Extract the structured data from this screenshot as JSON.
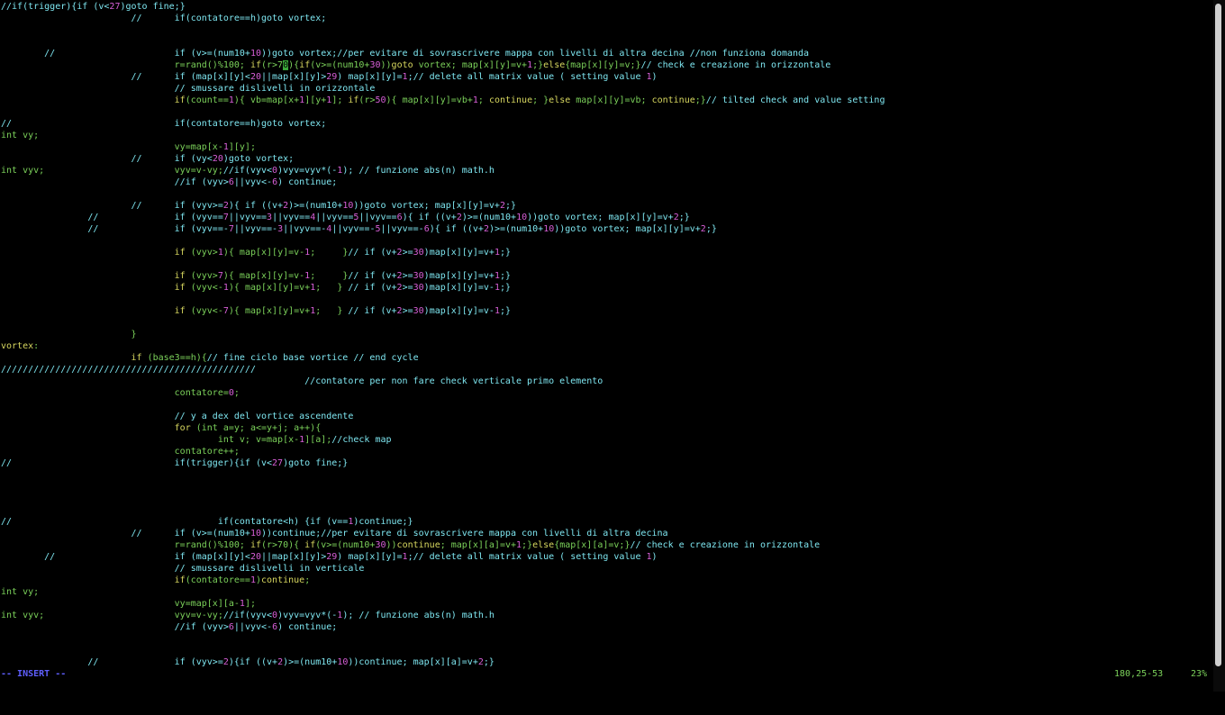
{
  "palette": {
    "d": "#7ee6f0",
    "g": "#7bd15a",
    "y": "#d7d75f",
    "m": "#d75fd7",
    "cur_bg": "#3aa83a",
    "cur_fg": "#000000"
  },
  "editor": {
    "lines": [
      [
        [
          "d",
          "//if(trigger){if (v<"
        ],
        [
          "m",
          "27"
        ],
        [
          "d",
          ")goto fine;}"
        ]
      ],
      [
        [
          "d",
          "                        //      if(contatore==h)goto vortex;"
        ]
      ],
      [],
      [],
      [
        [
          "d",
          "        //                      if (v>=(num10+"
        ],
        [
          "m",
          "10"
        ],
        [
          "d",
          "))goto vortex;//per evitare di sovrascrivere mappa con livelli di altra decina //non funziona domanda"
        ]
      ],
      [
        [
          "g",
          "                                r=rand()%100; "
        ],
        [
          "y",
          "if"
        ],
        [
          "g",
          "(r>7"
        ],
        [
          "cur",
          "0"
        ],
        [
          "g",
          "){"
        ],
        [
          "y",
          "if"
        ],
        [
          "g",
          "(v>=(num10+"
        ],
        [
          "m",
          "30"
        ],
        [
          "g",
          "))"
        ],
        [
          "y",
          "goto"
        ],
        [
          "g",
          " vortex; map[x][y]=v+"
        ],
        [
          "m",
          "1"
        ],
        [
          "g",
          ";}"
        ],
        [
          "y",
          "else"
        ],
        [
          "g",
          "{map[x][y]=v;}"
        ],
        [
          "d",
          "// check e creazione in orizzontale"
        ]
      ],
      [
        [
          "d",
          "                        //      if (map[x][y]<"
        ],
        [
          "m",
          "20"
        ],
        [
          "d",
          "||map[x][y]>"
        ],
        [
          "m",
          "29"
        ],
        [
          "d",
          ") map[x][y]="
        ],
        [
          "m",
          "1"
        ],
        [
          "d",
          ";// delete all matrix value ( setting value "
        ],
        [
          "m",
          "1"
        ],
        [
          "d",
          ")"
        ]
      ],
      [
        [
          "d",
          "                                // smussare dislivelli in orizzontale"
        ]
      ],
      [
        [
          "y",
          "                                if"
        ],
        [
          "g",
          "(count=="
        ],
        [
          "m",
          "1"
        ],
        [
          "g",
          "){ vb=map[x+"
        ],
        [
          "m",
          "1"
        ],
        [
          "g",
          "][y+"
        ],
        [
          "m",
          "1"
        ],
        [
          "g",
          "]; "
        ],
        [
          "y",
          "if"
        ],
        [
          "g",
          "(r>"
        ],
        [
          "m",
          "50"
        ],
        [
          "g",
          "){ map[x][y]=vb+"
        ],
        [
          "m",
          "1"
        ],
        [
          "g",
          "; "
        ],
        [
          "y",
          "continue"
        ],
        [
          "g",
          "; }"
        ],
        [
          "y",
          "else"
        ],
        [
          "g",
          " map[x][y]=vb; "
        ],
        [
          "y",
          "continue"
        ],
        [
          "g",
          ";}"
        ],
        [
          "d",
          "// tilted check and value setting"
        ]
      ],
      [],
      [
        [
          "d",
          "//                              if(contatore==h)goto vortex;"
        ]
      ],
      [
        [
          "g",
          "int vy;"
        ]
      ],
      [
        [
          "g",
          "                                vy=map[x-"
        ],
        [
          "m",
          "1"
        ],
        [
          "g",
          "][y];"
        ]
      ],
      [
        [
          "d",
          "                        //      if (vy<"
        ],
        [
          "m",
          "20"
        ],
        [
          "d",
          ")goto vortex;"
        ]
      ],
      [
        [
          "g",
          "int vyv;                        vyv=v-vy;"
        ],
        [
          "d",
          "//if(vyv<"
        ],
        [
          "m",
          "0"
        ],
        [
          "d",
          ")vyv=vyv*(-"
        ],
        [
          "m",
          "1"
        ],
        [
          "d",
          "); // funzione abs(n) math.h"
        ]
      ],
      [
        [
          "d",
          "                                //if (vyv>"
        ],
        [
          "m",
          "6"
        ],
        [
          "d",
          "||vyv<-"
        ],
        [
          "m",
          "6"
        ],
        [
          "d",
          ") continue;"
        ]
      ],
      [],
      [
        [
          "d",
          "                        //      if (vyv>="
        ],
        [
          "m",
          "2"
        ],
        [
          "d",
          "){ if ((v+"
        ],
        [
          "m",
          "2"
        ],
        [
          "d",
          ")>=(num10+"
        ],
        [
          "m",
          "10"
        ],
        [
          "d",
          "))goto vortex; map[x][y]=v+"
        ],
        [
          "m",
          "2"
        ],
        [
          "d",
          ";}"
        ]
      ],
      [
        [
          "d",
          "                //              if (vyv=="
        ],
        [
          "m",
          "7"
        ],
        [
          "d",
          "||vyv=="
        ],
        [
          "m",
          "3"
        ],
        [
          "d",
          "||vyv=="
        ],
        [
          "m",
          "4"
        ],
        [
          "d",
          "||vyv=="
        ],
        [
          "m",
          "5"
        ],
        [
          "d",
          "||vyv=="
        ],
        [
          "m",
          "6"
        ],
        [
          "d",
          "){ if ((v+"
        ],
        [
          "m",
          "2"
        ],
        [
          "d",
          ")>=(num10+"
        ],
        [
          "m",
          "10"
        ],
        [
          "d",
          "))goto vortex; map[x][y]=v+"
        ],
        [
          "m",
          "2"
        ],
        [
          "d",
          ";}"
        ]
      ],
      [
        [
          "d",
          "                //              if (vyv==-"
        ],
        [
          "m",
          "7"
        ],
        [
          "d",
          "||vyv==-"
        ],
        [
          "m",
          "3"
        ],
        [
          "d",
          "||vyv==-"
        ],
        [
          "m",
          "4"
        ],
        [
          "d",
          "||vyv==-"
        ],
        [
          "m",
          "5"
        ],
        [
          "d",
          "||vyv==-"
        ],
        [
          "m",
          "6"
        ],
        [
          "d",
          "){ if ((v+"
        ],
        [
          "m",
          "2"
        ],
        [
          "d",
          ")>=(num10+"
        ],
        [
          "m",
          "10"
        ],
        [
          "d",
          "))goto vortex; map[x][y]=v+"
        ],
        [
          "m",
          "2"
        ],
        [
          "d",
          ";}"
        ]
      ],
      [],
      [
        [
          "y",
          "                                if"
        ],
        [
          "g",
          " (vyv>"
        ],
        [
          "m",
          "1"
        ],
        [
          "g",
          "){ map[x][y]=v-"
        ],
        [
          "m",
          "1"
        ],
        [
          "g",
          ";     }"
        ],
        [
          "d",
          "// if (v+"
        ],
        [
          "m",
          "2"
        ],
        [
          "d",
          ">="
        ],
        [
          "m",
          "30"
        ],
        [
          "d",
          ")map[x][y]=v+"
        ],
        [
          "m",
          "1"
        ],
        [
          "d",
          ";}"
        ]
      ],
      [],
      [
        [
          "y",
          "                                if"
        ],
        [
          "g",
          " (vyv>"
        ],
        [
          "m",
          "7"
        ],
        [
          "g",
          "){ map[x][y]=v-"
        ],
        [
          "m",
          "1"
        ],
        [
          "g",
          ";     }"
        ],
        [
          "d",
          "// if (v+"
        ],
        [
          "m",
          "2"
        ],
        [
          "d",
          ">="
        ],
        [
          "m",
          "30"
        ],
        [
          "d",
          ")map[x][y]=v+"
        ],
        [
          "m",
          "1"
        ],
        [
          "d",
          ";}"
        ]
      ],
      [
        [
          "y",
          "                                if"
        ],
        [
          "g",
          " (vyv<-"
        ],
        [
          "m",
          "1"
        ],
        [
          "g",
          "){ map[x][y]=v+"
        ],
        [
          "m",
          "1"
        ],
        [
          "g",
          ";   } "
        ],
        [
          "d",
          "// if (v+"
        ],
        [
          "m",
          "2"
        ],
        [
          "d",
          ">="
        ],
        [
          "m",
          "30"
        ],
        [
          "d",
          ")map[x][y]=v-"
        ],
        [
          "m",
          "1"
        ],
        [
          "d",
          ";}"
        ]
      ],
      [],
      [
        [
          "y",
          "                                if"
        ],
        [
          "g",
          " (vyv<-"
        ],
        [
          "m",
          "7"
        ],
        [
          "g",
          "){ map[x][y]=v+"
        ],
        [
          "m",
          "1"
        ],
        [
          "g",
          ";   } "
        ],
        [
          "d",
          "// if (v+"
        ],
        [
          "m",
          "2"
        ],
        [
          "d",
          ">="
        ],
        [
          "m",
          "30"
        ],
        [
          "d",
          ")map[x][y]=v-"
        ],
        [
          "m",
          "1"
        ],
        [
          "d",
          ";}"
        ]
      ],
      [],
      [
        [
          "g",
          "                        }"
        ]
      ],
      [
        [
          "y",
          "vortex"
        ],
        [
          "g",
          ":"
        ]
      ],
      [
        [
          "y",
          "                        if"
        ],
        [
          "g",
          " (base3==h){"
        ],
        [
          "d",
          "// fine ciclo base vortice // end cycle"
        ]
      ],
      [
        [
          "d",
          "///////////////////////////////////////////////"
        ]
      ],
      [
        [
          "d",
          "                                                        //contatore per non fare check verticale primo elemento"
        ]
      ],
      [
        [
          "g",
          "                                contatore="
        ],
        [
          "m",
          "0"
        ],
        [
          "g",
          ";"
        ]
      ],
      [],
      [
        [
          "d",
          "                                // y a dex del vortice ascendente"
        ]
      ],
      [
        [
          "y",
          "                                for"
        ],
        [
          "g",
          " (int a=y; a<=y+j; a++){"
        ]
      ],
      [
        [
          "g",
          "                                        int v; v=map[x-"
        ],
        [
          "m",
          "1"
        ],
        [
          "g",
          "][a];"
        ],
        [
          "d",
          "//check map"
        ]
      ],
      [
        [
          "g",
          "                                contatore++;"
        ]
      ],
      [
        [
          "d",
          "//                              if(trigger){if (v<"
        ],
        [
          "m",
          "27"
        ],
        [
          "d",
          ")goto fine;}"
        ]
      ],
      [],
      [],
      [],
      [],
      [
        [
          "d",
          "//                                      if(contatore<h) {if (v=="
        ],
        [
          "m",
          "1"
        ],
        [
          "d",
          ")continue;}"
        ]
      ],
      [
        [
          "d",
          "                        //      if (v>=(num10+"
        ],
        [
          "m",
          "10"
        ],
        [
          "d",
          "))continue;//per evitare di sovrascrivere mappa con livelli di altra decina"
        ]
      ],
      [
        [
          "g",
          "                                r=rand()%100; "
        ],
        [
          "y",
          "if"
        ],
        [
          "g",
          "(r>70){ "
        ],
        [
          "y",
          "if"
        ],
        [
          "g",
          "(v>=(num10+"
        ],
        [
          "m",
          "30"
        ],
        [
          "g",
          "))"
        ],
        [
          "y",
          "continue"
        ],
        [
          "g",
          "; map[x][a]=v+"
        ],
        [
          "m",
          "1"
        ],
        [
          "g",
          ";}"
        ],
        [
          "y",
          "else"
        ],
        [
          "g",
          "{map[x][a]=v;}"
        ],
        [
          "d",
          "// check e creazione in orizzontale"
        ]
      ],
      [
        [
          "d",
          "        //                      if (map[x][y]<"
        ],
        [
          "m",
          "20"
        ],
        [
          "d",
          "||map[x][y]>"
        ],
        [
          "m",
          "29"
        ],
        [
          "d",
          ") map[x][y]="
        ],
        [
          "m",
          "1"
        ],
        [
          "d",
          ";// delete all matrix value ( setting value "
        ],
        [
          "m",
          "1"
        ],
        [
          "d",
          ")"
        ]
      ],
      [
        [
          "d",
          "                                // smussare dislivelli in verticale"
        ]
      ],
      [
        [
          "y",
          "                                if"
        ],
        [
          "g",
          "(contatore=="
        ],
        [
          "m",
          "1"
        ],
        [
          "g",
          ")"
        ],
        [
          "y",
          "continue"
        ],
        [
          "g",
          ";"
        ]
      ],
      [
        [
          "g",
          "int vy;"
        ]
      ],
      [
        [
          "g",
          "                                vy=map[x][a-"
        ],
        [
          "m",
          "1"
        ],
        [
          "g",
          "];"
        ]
      ],
      [
        [
          "g",
          "int vyv;                        vyv=v-vy;"
        ],
        [
          "d",
          "//if(vyv<"
        ],
        [
          "m",
          "0"
        ],
        [
          "d",
          ")vyv=vyv*(-"
        ],
        [
          "m",
          "1"
        ],
        [
          "d",
          "); // funzione abs(n) math.h"
        ]
      ],
      [
        [
          "d",
          "                                //if (vyv>"
        ],
        [
          "m",
          "6"
        ],
        [
          "d",
          "||vyv<-"
        ],
        [
          "m",
          "6"
        ],
        [
          "d",
          ") continue;"
        ]
      ],
      [],
      [],
      [
        [
          "d",
          "                //              if (vyv>="
        ],
        [
          "m",
          "2"
        ],
        [
          "d",
          "){if ((v+"
        ],
        [
          "m",
          "2"
        ],
        [
          "d",
          ")>=(num10+"
        ],
        [
          "m",
          "10"
        ],
        [
          "d",
          "))continue; map[x][a]=v+"
        ],
        [
          "m",
          "2"
        ],
        [
          "d",
          ";}"
        ]
      ]
    ]
  },
  "statusline": {
    "mode": "-- INSERT --",
    "position": "180,25-53",
    "percent": "23%"
  },
  "scrollbar": {
    "position_fraction": 0.23
  }
}
